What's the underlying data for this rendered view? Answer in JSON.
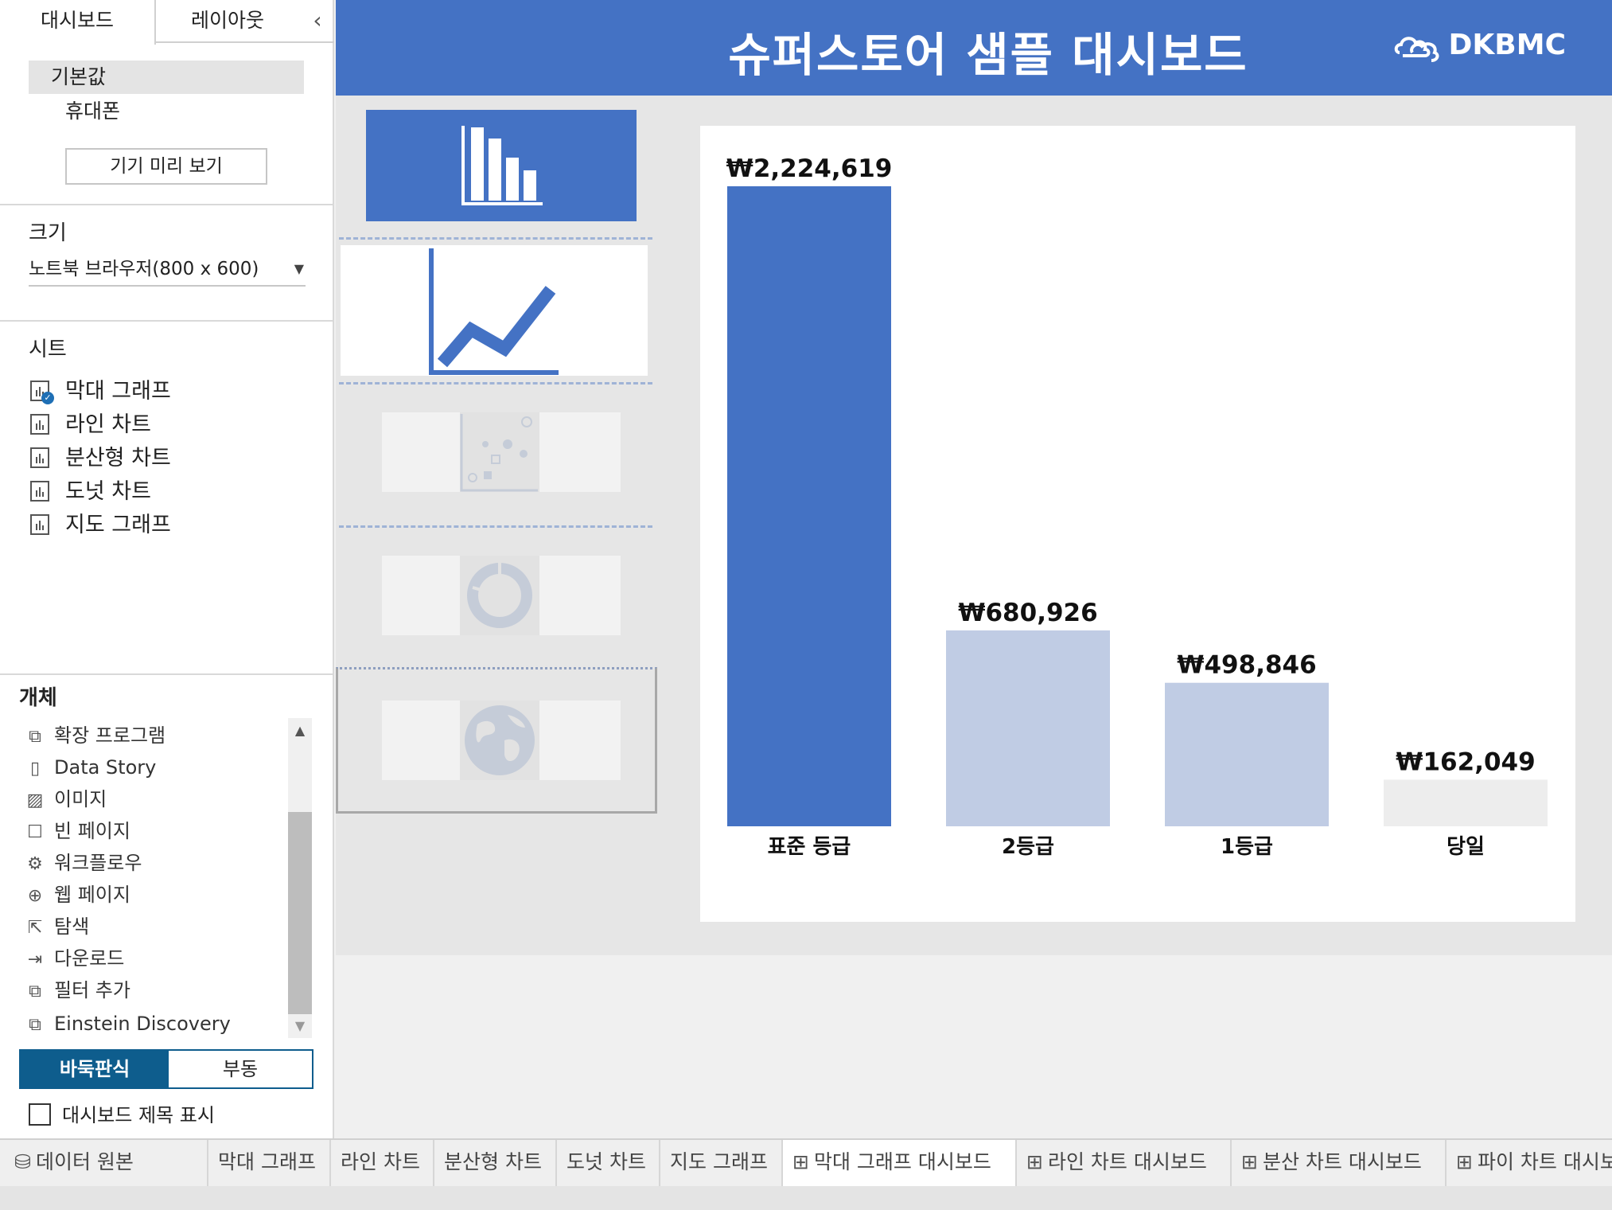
{
  "left_pane": {
    "tabs": [
      {
        "label": "대시보드"
      },
      {
        "label": "레이아웃"
      }
    ],
    "collapse_icon": "chevron-left-icon",
    "devices": {
      "default": "기본값",
      "phone": "휴대폰",
      "preview_button": "기기 미리 보기"
    },
    "size": {
      "title": "크기",
      "value": "노트북 브라우저(800 x 600)"
    },
    "sheets": {
      "title": "시트",
      "items": [
        {
          "label": "막대 그래프",
          "in_use": true
        },
        {
          "label": "라인 차트",
          "in_use": false
        },
        {
          "label": "분산형 차트",
          "in_use": false
        },
        {
          "label": "도넛 차트",
          "in_use": false
        },
        {
          "label": "지도 그래프",
          "in_use": false
        }
      ]
    },
    "objects": {
      "title": "개체",
      "items": [
        {
          "label": "확장 프로그램",
          "icon": "puzzle-icon"
        },
        {
          "label": "Data Story",
          "icon": "book-icon"
        },
        {
          "label": "이미지",
          "icon": "image-icon"
        },
        {
          "label": "빈 페이지",
          "icon": "blank-icon"
        },
        {
          "label": "워크플로우",
          "icon": "workflow-icon"
        },
        {
          "label": "웹 페이지",
          "icon": "globe-icon"
        },
        {
          "label": "탐색",
          "icon": "navigate-icon"
        },
        {
          "label": "다운로드",
          "icon": "download-icon"
        },
        {
          "label": "필터 추가",
          "icon": "puzzle-icon"
        },
        {
          "label": "Einstein Discovery",
          "icon": "puzzle-icon"
        }
      ]
    },
    "layout_mode": {
      "tiled": "바둑판식",
      "floating": "부동",
      "selected": "tiled"
    },
    "show_title": {
      "label": "대시보드 제목 표시",
      "checked": false
    }
  },
  "dashboard": {
    "title": "슈퍼스토어 샘플 대시보드",
    "logo_text": "DKBMC",
    "header_color": "#4472c4",
    "nav_selected": "bar-chart"
  },
  "chart_data": {
    "type": "bar",
    "categories": [
      "표준 등급",
      "2등급",
      "1등급",
      "당일"
    ],
    "values": [
      2224619,
      680926,
      498846,
      162049
    ],
    "labels": [
      "₩2,224,619",
      "₩680,926",
      "₩498,846",
      "₩162,049"
    ],
    "colors": [
      "#4472c4",
      "#c0cce4",
      "#c0cce4",
      "#ededed"
    ],
    "ylim": [
      0,
      2224619
    ],
    "title": "",
    "xlabel": "",
    "ylabel": "",
    "grid": false
  },
  "sheet_tabs": [
    {
      "label": "데이터 원본",
      "icon": "database-icon",
      "active": false
    },
    {
      "label": "막대 그래프",
      "icon": "",
      "active": false
    },
    {
      "label": "라인 차트",
      "icon": "",
      "active": false
    },
    {
      "label": "분산형 차트",
      "icon": "",
      "active": false
    },
    {
      "label": "도넛 차트",
      "icon": "",
      "active": false
    },
    {
      "label": "지도 그래프",
      "icon": "",
      "active": false
    },
    {
      "label": "막대 그래프 대시보드",
      "icon": "dashboard-icon",
      "active": true
    },
    {
      "label": "라인 차트 대시보드",
      "icon": "dashboard-icon",
      "active": false
    },
    {
      "label": "분산 차트 대시보드",
      "icon": "dashboard-icon",
      "active": false
    },
    {
      "label": "파이 차트 대시보드",
      "icon": "dashboard-icon",
      "active": false
    }
  ]
}
